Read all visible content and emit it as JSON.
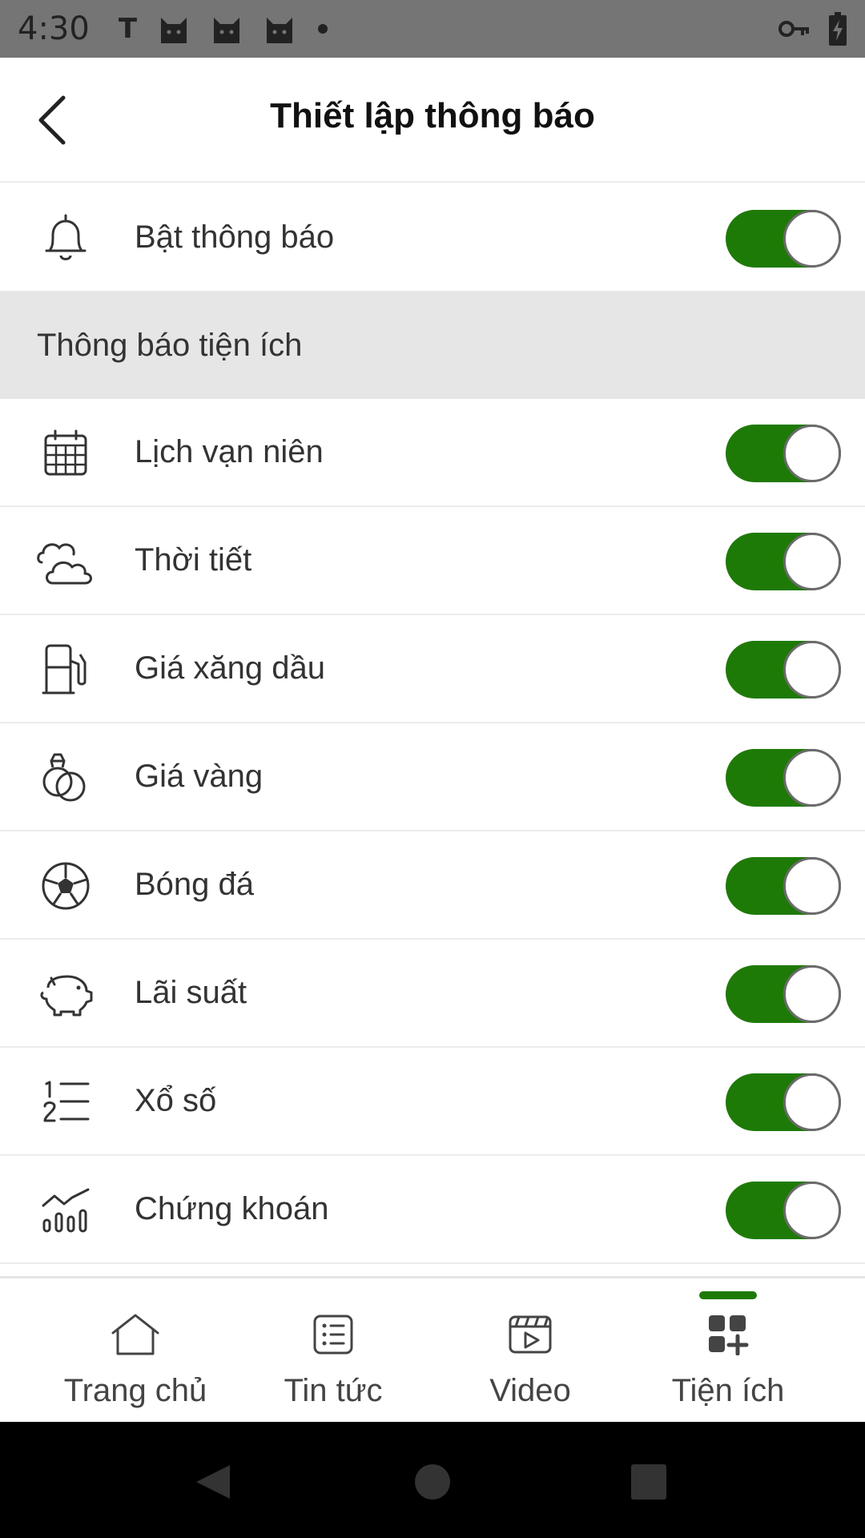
{
  "status_bar": {
    "time": "4:30",
    "carrier_letter": "T",
    "icons_left": [
      "t-icon",
      "cat-icon",
      "cat-icon",
      "cat-icon",
      "dot-icon"
    ],
    "icons_right": [
      "key-icon",
      "battery-charging-icon"
    ]
  },
  "header": {
    "title": "Thiết lập thông báo",
    "back_icon": "chevron-left-icon"
  },
  "master_toggle": {
    "label": "Bật thông báo",
    "icon": "bell-icon",
    "enabled": true
  },
  "section": {
    "title": "Thông báo tiện ích"
  },
  "items": [
    {
      "label": "Lịch vạn niên",
      "icon": "calendar-icon",
      "enabled": true
    },
    {
      "label": "Thời tiết",
      "icon": "cloud-icon",
      "enabled": true
    },
    {
      "label": "Giá xăng dầu",
      "icon": "fuel-pump-icon",
      "enabled": true
    },
    {
      "label": "Giá vàng",
      "icon": "rings-icon",
      "enabled": true
    },
    {
      "label": "Bóng đá",
      "icon": "soccer-ball-icon",
      "enabled": true
    },
    {
      "label": "Lãi suất",
      "icon": "piggy-bank-icon",
      "enabled": true
    },
    {
      "label": "Xổ số",
      "icon": "numbered-list-icon",
      "enabled": true
    },
    {
      "label": "Chứng khoán",
      "icon": "stock-chart-icon",
      "enabled": true
    }
  ],
  "bottom_nav": {
    "items": [
      {
        "label": "Trang chủ",
        "icon": "home-icon",
        "active": false
      },
      {
        "label": "Tin tức",
        "icon": "news-list-icon",
        "active": false
      },
      {
        "label": "Video",
        "icon": "video-clapper-icon",
        "active": false
      },
      {
        "label": "Tiện ích",
        "icon": "grid-plus-icon",
        "active": true
      }
    ]
  },
  "colors": {
    "accent": "#1e7a06",
    "status_bar": "#757575",
    "section_bg": "#e6e6e6",
    "system_nav": "#000000"
  }
}
